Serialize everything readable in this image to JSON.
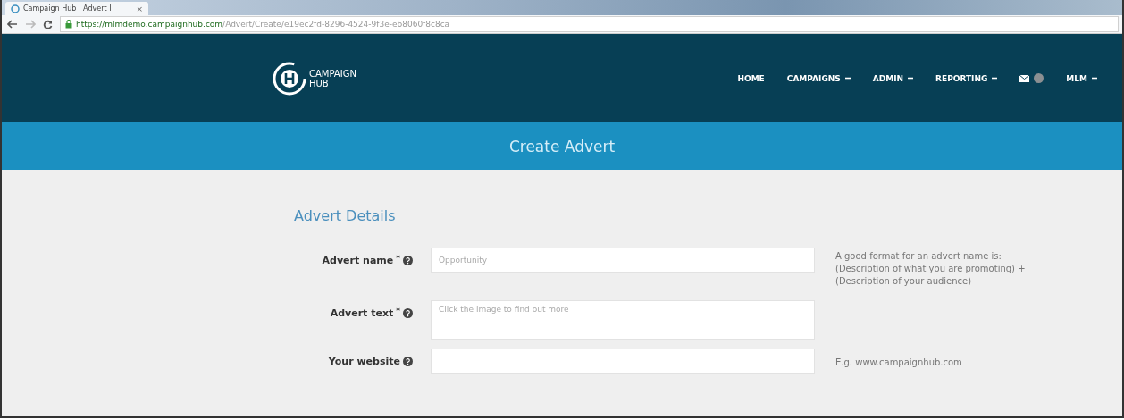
{
  "browser": {
    "tab_title": "Campaign Hub | Advert I",
    "tab_close": "×",
    "url_host": "https://mlmdemo.campaignhub.com",
    "url_path": "/Advert/Create/e19ec2fd-8296-4524-9f3e-eb8060f8c8ca"
  },
  "nav": {
    "logo_lines": [
      "CAMPAIGN",
      "HUB"
    ],
    "items": [
      {
        "kind": "link",
        "label": "HOME",
        "dropdown": false
      },
      {
        "kind": "link",
        "label": "CAMPAIGNS",
        "dropdown": true
      },
      {
        "kind": "link",
        "label": "ADMIN",
        "dropdown": true
      },
      {
        "kind": "link",
        "label": "REPORTING",
        "dropdown": true
      },
      {
        "kind": "messages",
        "dropdown": false
      },
      {
        "kind": "link",
        "label": "MLM",
        "dropdown": true
      }
    ]
  },
  "page_header": {
    "title": "Create Advert"
  },
  "form": {
    "section_title": "Advert Details",
    "fields": [
      {
        "kind": "input",
        "label": "Advert name",
        "required_mark": "*",
        "placeholder": "Opportunity",
        "hint_lines": [
          "A good format for an advert name is:",
          "(Description of what you are promoting) +",
          "(Description of your audience)"
        ]
      },
      {
        "kind": "textarea",
        "label": "Advert text",
        "required_mark": "*",
        "placeholder": "Click the image to find out more"
      },
      {
        "kind": "input",
        "label": "Your website",
        "hint_lines": [
          "E.g. www.campaignhub.com"
        ]
      }
    ]
  }
}
